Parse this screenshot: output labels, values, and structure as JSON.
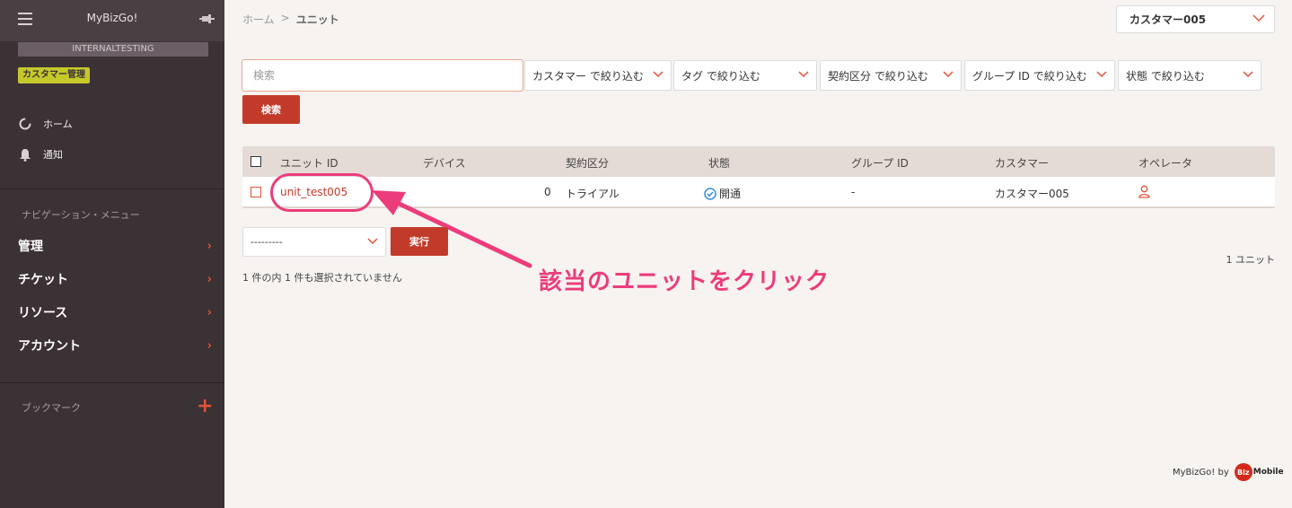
{
  "sidebar": {
    "app_title": "MyBizGo!",
    "tenant": "INTERNALTESTING",
    "role_badge": "カスタマー管理",
    "quick_links": [
      {
        "label": "ホーム",
        "icon": "spinner-icon"
      },
      {
        "label": "通知",
        "icon": "bell-icon"
      }
    ],
    "nav_section_label": "ナビゲーション・メニュー",
    "menu": [
      {
        "label": "管理"
      },
      {
        "label": "チケット"
      },
      {
        "label": "リソース"
      },
      {
        "label": "アカウント"
      }
    ],
    "bookmark_label": "ブックマーク"
  },
  "breadcrumb": {
    "home": "ホーム",
    "separator": ">",
    "current": "ユニット"
  },
  "customer_selector": {
    "value": "カスタマー005"
  },
  "search": {
    "placeholder": "検索",
    "button_label": "検索"
  },
  "filters": [
    {
      "label": "カスタマー で絞り込む"
    },
    {
      "label": "タグ で絞り込む"
    },
    {
      "label": "契約区分 で絞り込む"
    },
    {
      "label": "グループ ID で絞り込む"
    },
    {
      "label": "状態 で絞り込む"
    }
  ],
  "table": {
    "columns": [
      "ユニット ID",
      "デバイス",
      "契約区分",
      "状態",
      "グループ ID",
      "カスタマー",
      "オペレータ"
    ],
    "rows": [
      {
        "unit_id": "unit_test005",
        "devices": "0",
        "contract": "トライアル",
        "status": "開通",
        "group_id": "-",
        "customer": "カスタマー005"
      }
    ]
  },
  "actions": {
    "select_value": "---------",
    "run_label": "実行"
  },
  "count_label": "1 ユニット",
  "selection_info": "1 件の内 1 件も選択されていません",
  "annotation_text": "該当のユニットをクリック",
  "footer": {
    "text": "MyBizGo! by",
    "logo_circle": "Biz",
    "logo_text": "Mobile"
  },
  "colors": {
    "sidebar_bg": "#3b3236",
    "accent_red": "#c23b2a",
    "annotation_pink": "#ec3c7b",
    "badge_yellow": "#c5c82a"
  }
}
